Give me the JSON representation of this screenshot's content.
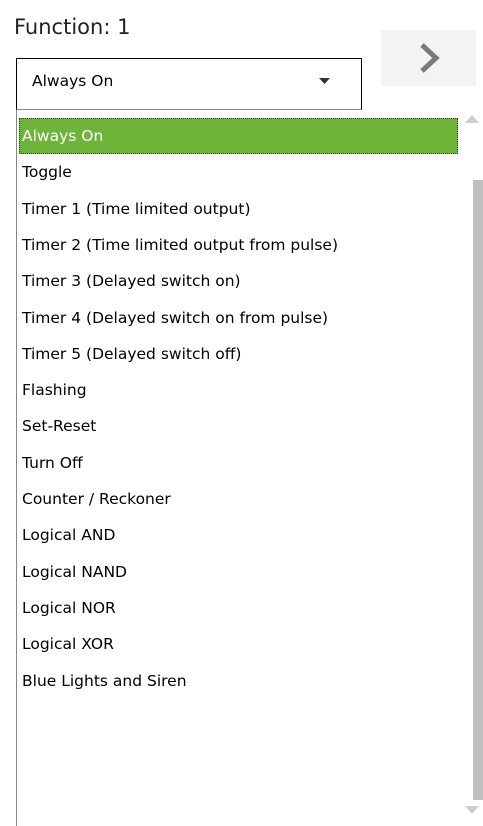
{
  "header": {
    "function_label": "Function: 1"
  },
  "combo": {
    "selected_value": "Always On"
  },
  "dropdown": {
    "selected_index": 0,
    "options": [
      "Always On",
      "Toggle",
      "Timer 1 (Time limited output)",
      "Timer 2 (Time limited output from pulse)",
      "Timer 3 (Delayed switch on)",
      "Timer 4 (Delayed switch on from pulse)",
      "Timer 5 (Delayed switch off)",
      "Flashing",
      "Set-Reset",
      "Turn Off",
      "Counter / Reckoner",
      "Logical AND",
      "Logical NAND",
      "Logical NOR",
      "Logical XOR",
      "Blue Lights and Siren"
    ]
  },
  "colors": {
    "selection": "#6fb43a",
    "scroll_thumb": "#c0c0c0",
    "next_button": "#f3f3f3"
  },
  "icons": {
    "next": "chevron-right-icon",
    "dropdown": "caret-down-icon",
    "scroll_up": "scroll-up-arrow-icon",
    "scroll_down": "scroll-down-arrow-icon"
  }
}
